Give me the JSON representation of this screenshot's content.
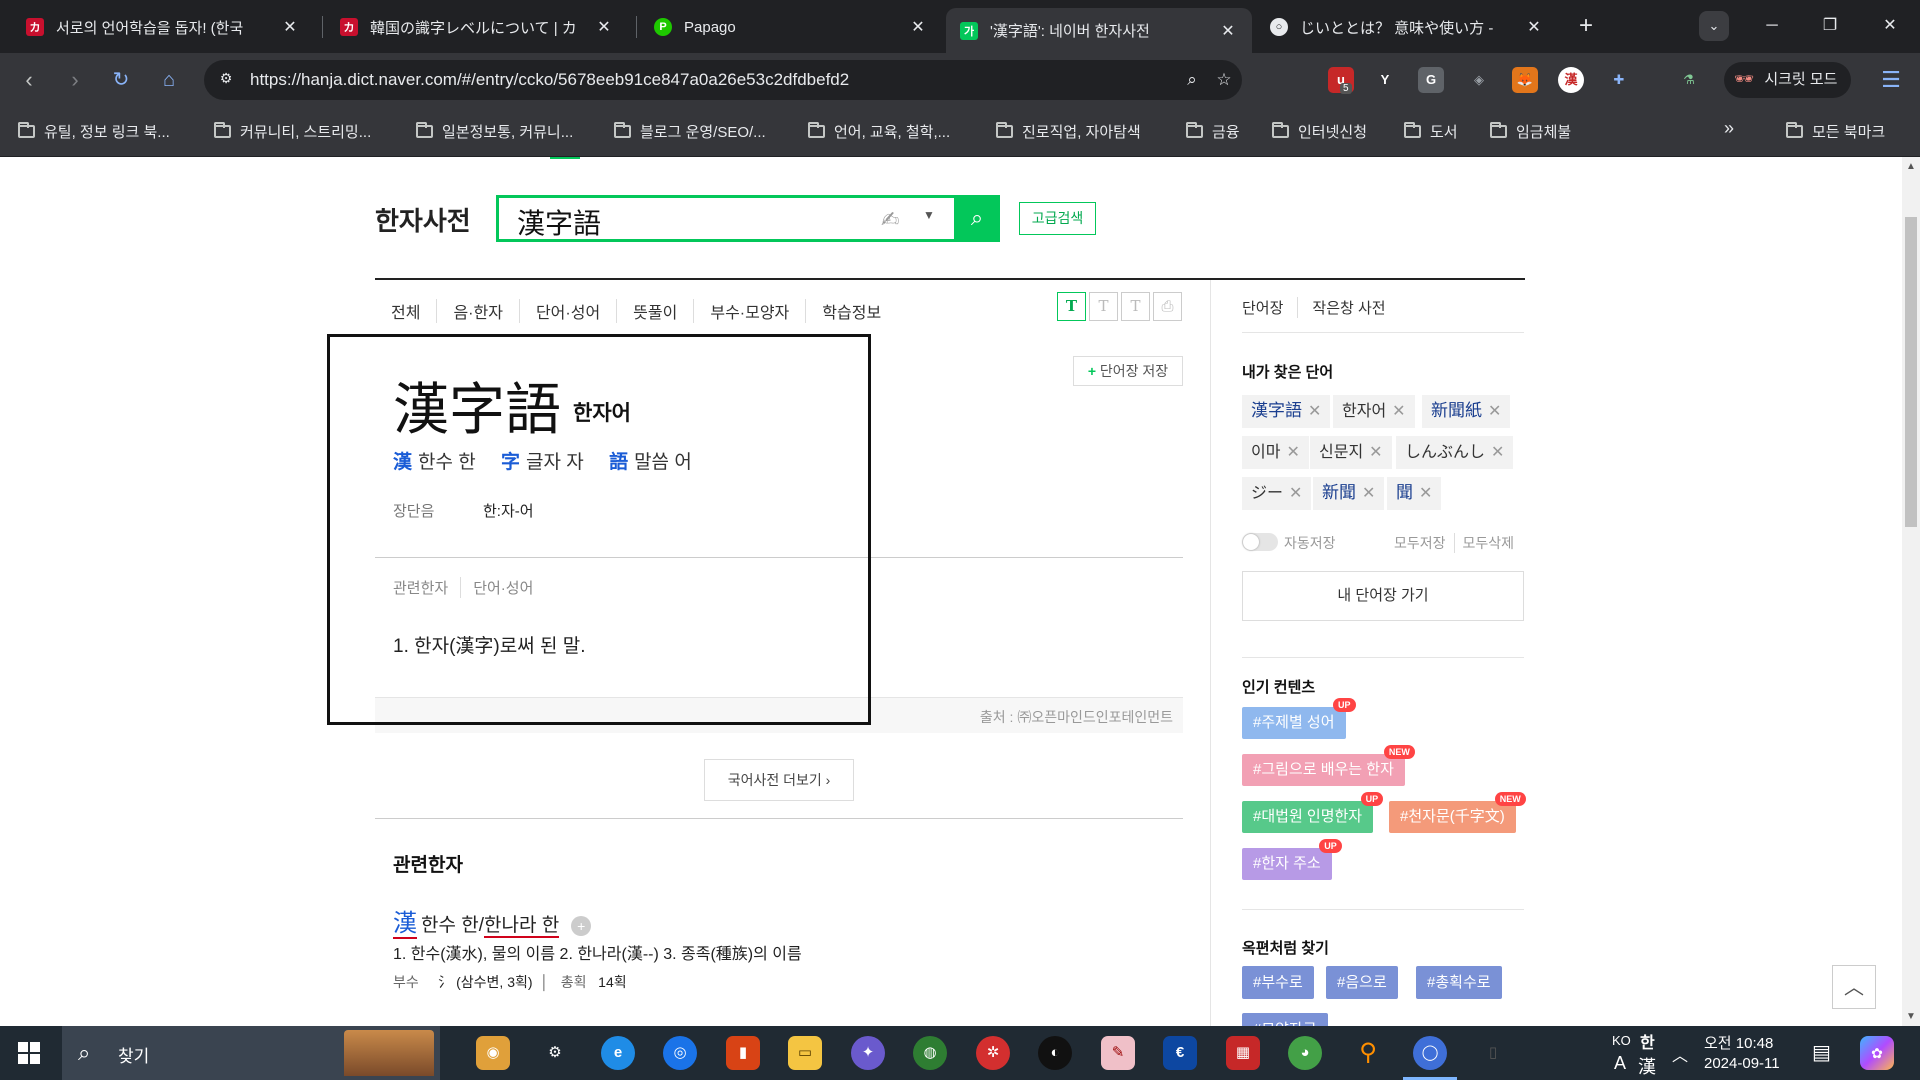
{
  "browser": {
    "tabs": [
      {
        "title": "서로의 언어학습을 돕자! (한국",
        "favicon": "カ",
        "favicon_color": "#c8102e"
      },
      {
        "title": "韓国の識字レベルについて | カ",
        "favicon": "カ",
        "favicon_color": "#c8102e"
      },
      {
        "title": "Papago",
        "favicon": "P",
        "favicon_color": "#1ec800"
      },
      {
        "title": "'漢字語': 네이버 한자사전",
        "favicon": "가",
        "favicon_color": "#03c75a"
      },
      {
        "title": "じいととは？ 意味や使い方 - ",
        "favicon": "○",
        "favicon_color": "#3b3b3b"
      }
    ],
    "new_tab": "+",
    "url": "https://hanja.dict.naver.com/#/entry/ccko/5678eeb91ce847a0a26e53c2dfdbefd2",
    "incognito_label": "시크릿 모드",
    "extension_badge": "5",
    "bookmarks": [
      "유틸, 정보 링크 북...",
      "커뮤니티, 스트리밍...",
      "일본정보통, 커뮤니...",
      "블로그 운영/SEO/...",
      "언어, 교육, 철학,...",
      "진로직업, 자아탐색",
      "금융",
      "인터넷신청",
      "도서",
      "임금체불"
    ],
    "bookmarks_more": "»",
    "all_bookmarks": "모든 북마크"
  },
  "dict": {
    "logo": "한자사전",
    "search_query": "漢字語",
    "advanced_search": "고급검색",
    "tabs": [
      "전체",
      "음·한자",
      "단어·성어",
      "뜻풀이",
      "부수·모양자",
      "학습정보"
    ],
    "font_sizes": [
      "T",
      "T",
      "T"
    ],
    "save_to_wordbook": "단어장 저장",
    "entry": {
      "word": "漢字語",
      "reading": "한자어",
      "chars": [
        {
          "hanja": "漢",
          "meaning": "한수 한"
        },
        {
          "hanja": "字",
          "meaning": "글자 자"
        },
        {
          "hanja": "語",
          "meaning": "말씀 어"
        }
      ],
      "pron_label": "장단음",
      "pron_value": "한:자-어",
      "subtabs": [
        "관련한자",
        "단어·성어"
      ],
      "definition": "1.  한자(漢字)로써 된 말.",
      "source": "출처 : ㈜오픈마인드인포테인먼트"
    },
    "more_korean_dict": "국어사전 더보기",
    "related": {
      "title": "관련한자",
      "hanja": "漢",
      "reading_a": "한수 한/",
      "reading_b": "한나라 한",
      "desc": "1. 한수(漢水), 물의 이름 2. 한나라(漢--) 3. 종족(種族)의 이름",
      "radical_label": "부수",
      "radical_value": "氵 (삼수변, 3획)",
      "strokes_label": "총획",
      "strokes_value": "14획"
    }
  },
  "sidebar": {
    "tabs": [
      "단어장",
      "작은창 사전"
    ],
    "recent_title": "내가 찾은 단어",
    "recent_words": [
      "漢字語",
      "한자어",
      "新聞紙",
      "이마",
      "신문지",
      "しんぶんし",
      "ジー",
      "新聞",
      "聞"
    ],
    "autosave": "자동저장",
    "save_all": "모두저장",
    "delete_all": "모두삭제",
    "go_wordbook": "내 단어장 가기",
    "popular_title": "인기 컨텐츠",
    "popular": [
      {
        "label": "#주제별 성어",
        "badge": "UP",
        "color": "#8fb8ee"
      },
      {
        "label": "#그림으로 배우는 한자",
        "badge": "NEW",
        "color": "#f2a0b4"
      },
      {
        "label": "#대법원 인명한자",
        "badge": "UP",
        "color": "#57c98a"
      },
      {
        "label": "#천자문(千字文)",
        "badge": "NEW",
        "color": "#f49a7a"
      },
      {
        "label": "#한자 주소",
        "badge": "UP",
        "color": "#b79ae6"
      }
    ],
    "okpyeon_title": "옥편처럼 찾기",
    "okpyeon": [
      "#부수로",
      "#음으로",
      "#총획수로",
      "#모양자로"
    ]
  },
  "taskbar": {
    "search_label": "찾기",
    "lang": "KO",
    "ime_top": "한",
    "ime_bottom_a": "A",
    "ime_bottom_b": "漢",
    "time": "오전 10:48",
    "date": "2024-09-11"
  }
}
